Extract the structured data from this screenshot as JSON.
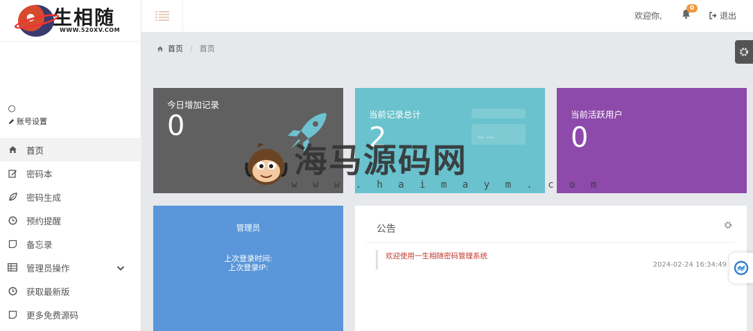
{
  "logo": {
    "title": "生相随",
    "url": "WWW.520XV.COM"
  },
  "user": {
    "settings_label": "账号设置"
  },
  "sidebar": {
    "items": [
      {
        "label": "首页",
        "icon": "home-icon"
      },
      {
        "label": "密码本",
        "icon": "edit-icon"
      },
      {
        "label": "密码生成",
        "icon": "leaf-icon"
      },
      {
        "label": "预约提醒",
        "icon": "clock-icon"
      },
      {
        "label": "备忘录",
        "icon": "note-icon"
      },
      {
        "label": "管理员操作",
        "icon": "table-icon"
      },
      {
        "label": "获取最新版",
        "icon": "clock-icon"
      },
      {
        "label": "更多免费源码",
        "icon": "note-icon"
      }
    ]
  },
  "topbar": {
    "welcome": "欢迎你,",
    "notification_count": "0",
    "logout": "退出"
  },
  "breadcrumb": {
    "home": "首页",
    "current": "首页"
  },
  "stats": {
    "today_records": {
      "label": "今日增加记录",
      "value": "0"
    },
    "total_records": {
      "label": "当前记录总计",
      "value": "2"
    },
    "active_users": {
      "label": "当前活跃用户",
      "value": "0"
    }
  },
  "admin": {
    "title": "管理员",
    "last_login_time": "上次登录时间:",
    "last_login_ip": "上次登录IP:"
  },
  "notice": {
    "title": "公告",
    "items": [
      {
        "text": "欢迎使用一生相随密码管理系统",
        "time": "2024-02-24 16:34:49"
      }
    ]
  },
  "watermark": {
    "name": "海马源码网",
    "url": "w w w . h a i m a y m . c o m"
  },
  "colors": {
    "card_gray": "#606060",
    "card_teal": "#69c2cd",
    "card_purple": "#8d4aaa",
    "admin_blue": "#5a96d9",
    "badge_orange": "#f0973a",
    "notice_red": "#c0392b"
  }
}
